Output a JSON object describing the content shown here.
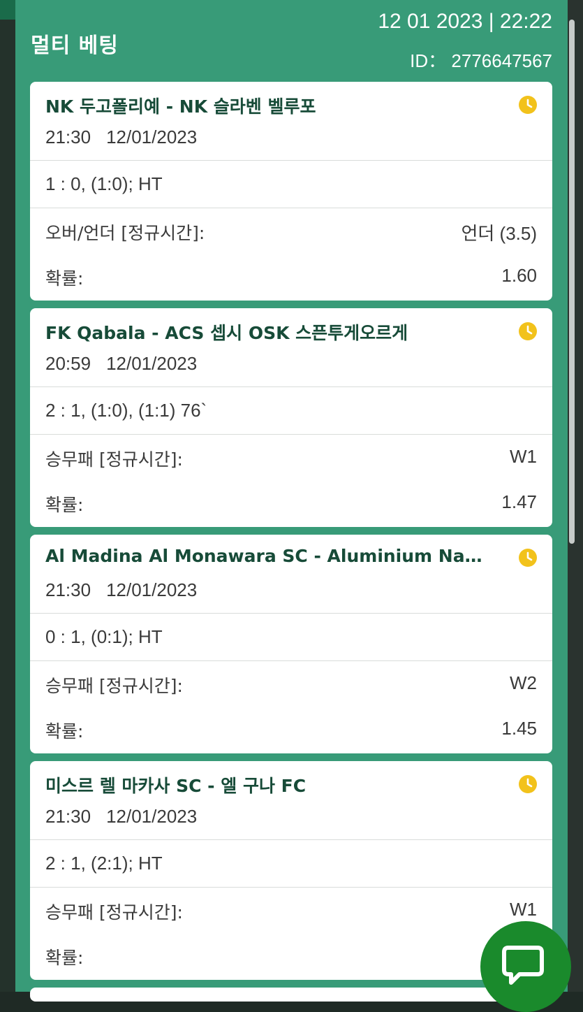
{
  "header": {
    "title": "멀티 베팅",
    "datetime": "12 01 2023 | 22:22",
    "bet_id": "ID： 2776647567"
  },
  "bets": [
    {
      "match": "NK 두고폴리예 - NK 슬라벤 벨루포",
      "time": "21:30",
      "date": "12/01/2023",
      "score": "1 : 0, (1:0); HT",
      "market": "오버/언더 [정규시간]:",
      "selection": "언더 (3.5)",
      "odds_label": "확률:",
      "odds": "1.60"
    },
    {
      "match": "FK Qabala - ACS 셉시 OSK 스픈투게오르게",
      "time": "20:59",
      "date": "12/01/2023",
      "score": "2 : 1, (1:0), (1:1) 76`",
      "market": "승무패 [정규시간]:",
      "selection": "W1",
      "odds_label": "확률:",
      "odds": "1.47"
    },
    {
      "match": "Al Madina Al Monawara SC - Aluminium Nag Hammadi",
      "time": "21:30",
      "date": "12/01/2023",
      "score": "0 : 1, (0:1); HT",
      "market": "승무패 [정규시간]:",
      "selection": "W2",
      "odds_label": "확률:",
      "odds": "1.45"
    },
    {
      "match": "미스르 렐 마카사 SC - 엘 구나 FC",
      "time": "21:30",
      "date": "12/01/2023",
      "score": "2 : 1, (2:1); HT",
      "market": "승무패 [정규시간]:",
      "selection": "W1",
      "odds_label": "확률:",
      "odds": ""
    }
  ],
  "icons": {
    "status": "clock-icon",
    "chat": "chat-bubble-icon"
  },
  "colors": {
    "panel": "#389b78",
    "title_text": "#174b38",
    "clock": "#f2c21b",
    "chat_button": "#1a8a2c"
  }
}
